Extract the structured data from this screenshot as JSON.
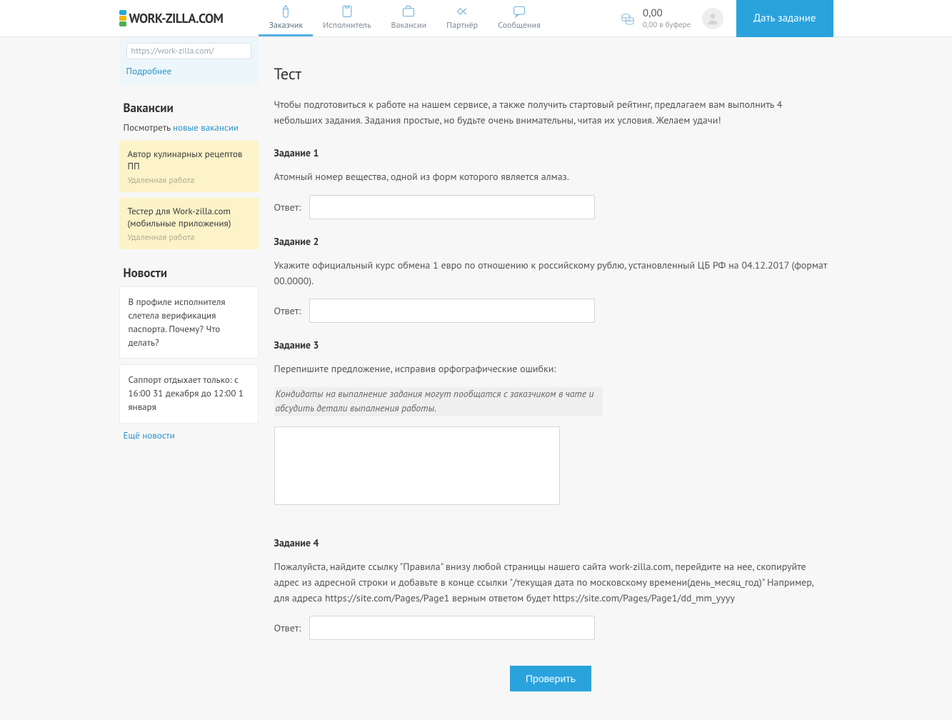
{
  "header": {
    "logo_text": "WORK-ZILLA.COM",
    "nav": [
      {
        "label": "Заказчик"
      },
      {
        "label": "Исполнитель"
      },
      {
        "label": "Вакансии"
      },
      {
        "label": "Партнёр"
      },
      {
        "label": "Сообщения"
      }
    ],
    "balance": "0,00",
    "balance_sub": "0,00 в буфере",
    "cta": "Дать задание"
  },
  "sidebar": {
    "url_hint": "https://work-zilla.com/",
    "more": "Подробнее",
    "vac_head": "Вакансии",
    "vac_look": "Посмотреть",
    "vac_link": "новые вакансии",
    "vacancies": [
      {
        "title": "Автор кулинарных рецептов ПП",
        "sub": "Удаленная работа"
      },
      {
        "title": "Тестер для Work-zilla.com (мобильные приложения)",
        "sub": "Удаленная работа"
      }
    ],
    "news_head": "Новости",
    "news": [
      "В профиле исполнителя слетела верификация паспорта. Почему? Что делать?",
      "Саппорт отдыхает только: с 16:00 31 декабря до 12:00 1 января"
    ],
    "more_news": "Ещё новости"
  },
  "main": {
    "title": "Тест",
    "intro": "Чтобы подготовиться к работе на нашем сервисе, а также получить стартовый рейтинг, предлагаем вам выполнить 4 небольших задания. Задания простые, но будьте очень внимательны, читая их условия. Желаем удачи!",
    "answer_label": "Ответ:",
    "tasks": [
      {
        "title": "Задание 1",
        "q": "Атомный номер вещества, одной из форм которого является алмаз."
      },
      {
        "title": "Задание 2",
        "q": "Укажите официальный курс обмена 1 евро по отношению к российскому рублю, установленный ЦБ РФ на 04.12.2017 (формат 00.0000)."
      },
      {
        "title": "Задание 3",
        "q": "Перепишите предложение, исправив орфографические ошибки:",
        "quote": "Кондидаты на выпалнение задания могут пообщатся с заказчиком в чате и абсудить детали выпалнения работы."
      },
      {
        "title": "Задание 4",
        "q": "Пожалуйста, найдите ссылку \"Правила\" внизу любой страницы нашего сайта work-zilla.com, перейдите на нее, скопируйте адрес из адресной строки и добавьте в конце ссылки \"/текущая дата по московскому времени(день_месяц_год)\" Например, для адреса https://site.com/Pages/Page1 верным ответом будет https://site.com/Pages/Page1/dd_mm_yyyy"
      }
    ],
    "submit": "Проверить"
  }
}
